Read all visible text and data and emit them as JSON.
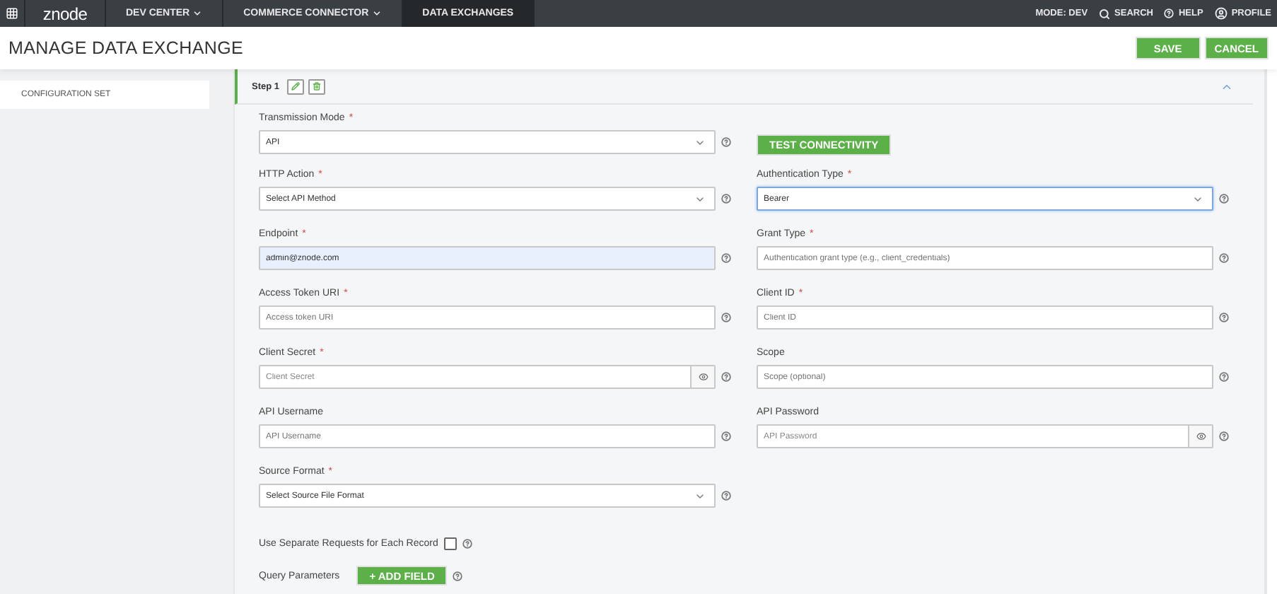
{
  "nav": {
    "logo": "znode",
    "items": [
      {
        "label": "DEV CENTER",
        "dropdown": true,
        "selected": false
      },
      {
        "label": "COMMERCE CONNECTOR",
        "dropdown": true,
        "selected": false
      },
      {
        "label": "DATA EXCHANGES",
        "dropdown": false,
        "selected": true
      }
    ],
    "right": [
      {
        "kind": "text",
        "label": "MODE: DEV"
      },
      {
        "kind": "search",
        "label": "SEARCH"
      },
      {
        "kind": "help",
        "label": "HELP"
      },
      {
        "kind": "profile",
        "label": "PROFILE"
      }
    ]
  },
  "page": {
    "title": "MANAGE DATA EXCHANGE",
    "buttons": [
      "SAVE",
      "CANCEL"
    ]
  },
  "sidebar": {
    "items": [
      {
        "label": "CONFIGURATION SET",
        "selected": true
      }
    ]
  },
  "step": {
    "title": "Step 1",
    "expanded": true
  },
  "rows": [
    {
      "left": {
        "kind": "select",
        "label": "Transmission Mode",
        "required": "*",
        "value": "API",
        "focused": false,
        "autofilled": false
      },
      "right": {
        "kind": "button",
        "label": "TEST CONNECTIVITY"
      }
    },
    {
      "left": {
        "kind": "select",
        "label": "HTTP Action",
        "required": "*",
        "value": "Select API Method",
        "focused": false,
        "autofilled": false
      },
      "right": {
        "kind": "select",
        "label": "Authentication Type",
        "required": "*",
        "value": "Bearer",
        "focused": true,
        "autofilled": false
      }
    },
    {
      "left": {
        "kind": "input",
        "label": "Endpoint",
        "required": "*",
        "value": "admin@znode.com",
        "focused": false,
        "autofilled": true
      },
      "right": {
        "kind": "input",
        "label": "Grant Type",
        "required": "*",
        "placeholder": "Authentication grant type (e.g., client_credentials)",
        "focused": false,
        "autofilled": false
      }
    },
    {
      "left": {
        "kind": "input",
        "label": "Access Token URI",
        "required": "*",
        "placeholder": "Access token URI",
        "focused": false,
        "autofilled": false
      },
      "right": {
        "kind": "input",
        "label": "Client ID",
        "required": "*",
        "placeholder": "Client ID",
        "focused": false,
        "autofilled": false
      }
    },
    {
      "left": {
        "kind": "password",
        "label": "Client Secret",
        "required": "*",
        "placeholder": "Client Secret",
        "focused": false,
        "autofilled": false
      },
      "right": {
        "kind": "input",
        "label": "Scope",
        "placeholder": "Scope (optional)",
        "focused": false,
        "autofilled": false
      }
    },
    {
      "left": {
        "kind": "input",
        "label": "API Username",
        "placeholder": "API Username",
        "focused": false,
        "autofilled": false
      },
      "right": {
        "kind": "password",
        "label": "API Password",
        "placeholder": "API Password",
        "focused": false,
        "autofilled": false
      }
    },
    {
      "left": {
        "kind": "select",
        "label": "Source Format",
        "required": "*",
        "value": "Select Source File Format",
        "focused": false,
        "autofilled": false
      }
    },
    {
      "left": {
        "kind": "checkbox",
        "label": "Use Separate Requests for Each Record",
        "checked": false
      }
    },
    {
      "left": {
        "kind": "add",
        "label": "Query Parameters",
        "button": "+ ADD FIELD"
      }
    }
  ]
}
